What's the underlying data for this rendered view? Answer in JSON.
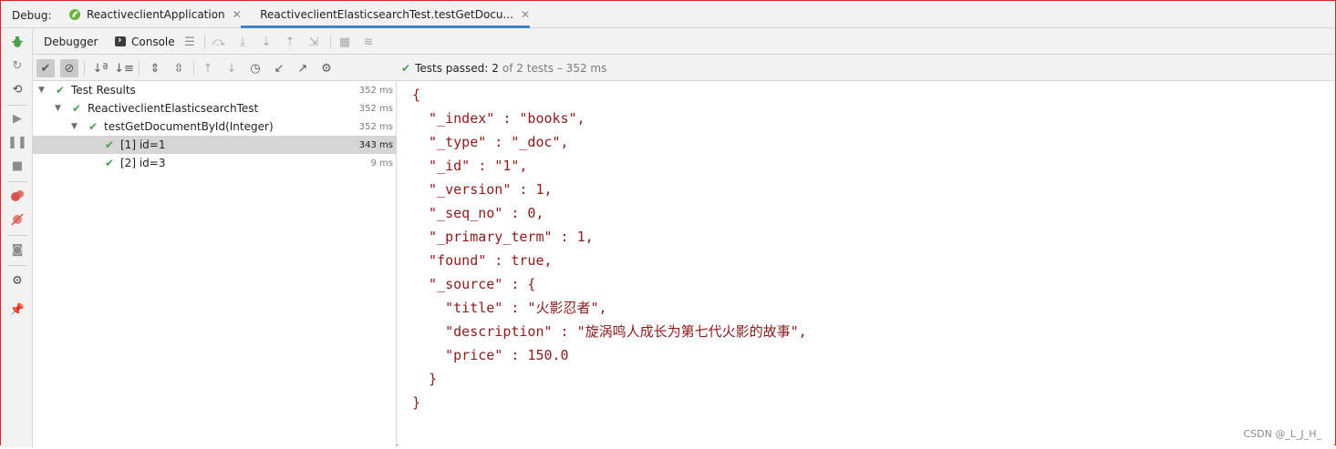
{
  "topbar": {
    "label": "Debug:",
    "tabs": [
      {
        "label": "ReactiveclientApplication",
        "icon": "spring-boot-icon"
      },
      {
        "label": "ReactiveclientElasticsearchTest.testGetDocu...",
        "icon": "junit-run-icon"
      }
    ]
  },
  "subtabs": {
    "debugger": "Debugger",
    "console": "Console"
  },
  "left_strip_icons": [
    "bug-icon",
    "rerun-icon",
    "restore-layout-icon",
    "resume-icon",
    "pause-icon",
    "stop-icon",
    "view-breakpoints-icon",
    "mute-breakpoints-icon",
    "screenshot-icon",
    "settings-icon",
    "pin-icon"
  ],
  "runner_toolbar_icons": [
    "show-passed-icon",
    "show-ignored-icon",
    "sort-alphabetically-icon",
    "sort-by-duration-icon",
    "expand-all-icon",
    "collapse-all-icon",
    "previous-failed-icon",
    "next-failed-icon",
    "test-history-icon",
    "import-tests-icon",
    "export-tests-icon",
    "settings-icon"
  ],
  "status": {
    "passed_label": "Tests passed:",
    "count": "2",
    "rest": "of 2 tests – 352 ms"
  },
  "tree": [
    {
      "label": "Test Results",
      "time": "352 ms"
    },
    {
      "label": "ReactiveclientElasticsearchTest",
      "time": "352 ms"
    },
    {
      "label": "testGetDocumentById(Integer)",
      "time": "352 ms"
    },
    {
      "label": "[1] id=1",
      "time": "343 ms"
    },
    {
      "label": "[2] id=3",
      "time": "9 ms"
    }
  ],
  "console_lines": [
    "{",
    "  \"_index\" : \"books\",",
    "  \"_type\" : \"_doc\",",
    "  \"_id\" : \"1\",",
    "  \"_version\" : 1,",
    "  \"_seq_no\" : 0,",
    "  \"_primary_term\" : 1,",
    "  \"found\" : true,",
    "  \"_source\" : {",
    "    \"title\" : \"火影忍者\",",
    "    \"description\" : \"旋涡鸣人成长为第七代火影的故事\",",
    "    \"price\" : 150.0",
    "  }",
    "}"
  ],
  "watermark": "CSDN @_L_J_H_",
  "colors": {
    "pass_green": "#4d9e4d",
    "console_text": "#8b1a1a",
    "active_tab_underline": "#4083c9",
    "frame_border": "#e02020"
  }
}
